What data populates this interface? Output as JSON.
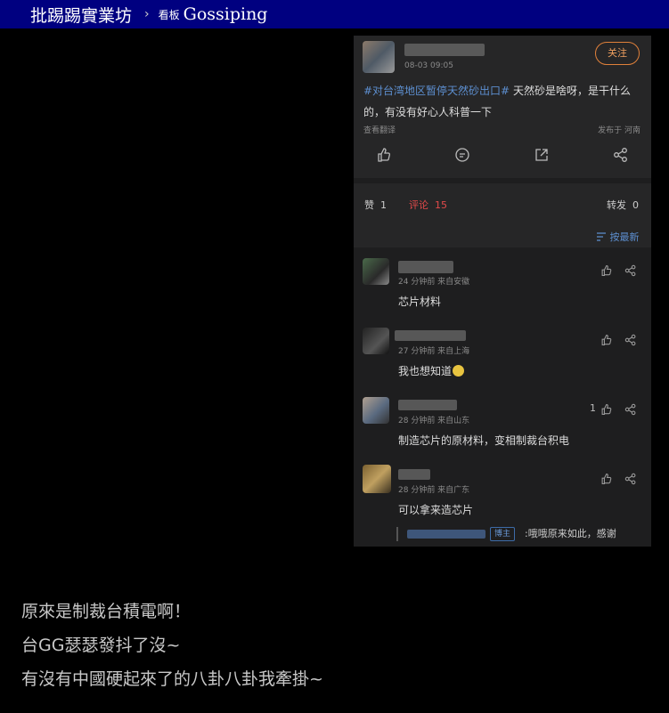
{
  "topbar": {
    "site_name": "批踢踢實業坊",
    "separator": "›",
    "board_label": "看板",
    "board_name": "Gossiping"
  },
  "post": {
    "follow_label": "关注",
    "time": "08-03 09:05",
    "hashtag": "#对台湾地区暂停天然砂出口#",
    "text": " 天然砂是啥呀，是干什么的，有没有好心人科普一下",
    "translate_label": "查看翻译",
    "location": "发布于 河南",
    "action_icons": [
      "thumb-up-icon",
      "comment-icon",
      "share-icon",
      "network-share-icon"
    ]
  },
  "stats": {
    "likes_label": "赞",
    "likes": "1",
    "comments_label": "评论",
    "comments": "15",
    "reposts_label": "转发",
    "reposts": "0",
    "sort_label": "按最新"
  },
  "comments": [
    {
      "meta": "24 分钟前  来自安徽",
      "text": "芯片材料",
      "likes": ""
    },
    {
      "meta": "27 分钟前  来自上海",
      "text": "我也想知道",
      "likes": ""
    },
    {
      "meta": "28 分钟前  来自山东",
      "text": "制造芯片的原材料，变相制裁台积电",
      "likes": "1"
    },
    {
      "meta": "28 分钟前  来自广东",
      "text": "可以拿来造芯片",
      "likes": ""
    }
  ],
  "reply": {
    "badge": "博主",
    "text": ":哦哦原来如此，感谢"
  },
  "body_lines": [
    "原來是制裁台積電啊！",
    "台GG瑟瑟發抖了沒~",
    "有沒有中國硬起來了的八卦八卦我牽掛~"
  ],
  "colors": {
    "topbar_bg": "#000080",
    "accent_orange": "#e0803a",
    "hashtag_blue": "#5d8fd0",
    "comment_active_red": "#e24a4a"
  }
}
